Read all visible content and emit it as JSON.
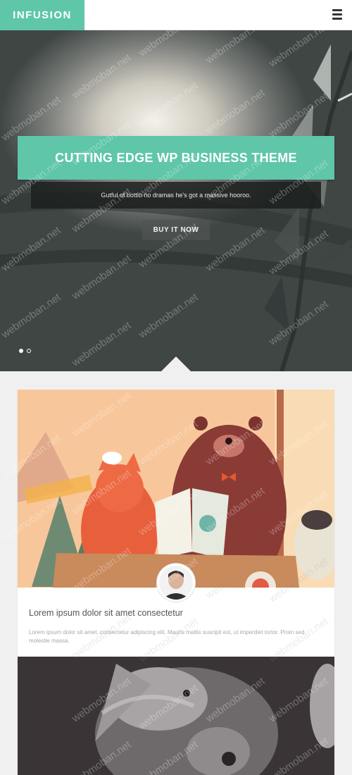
{
  "header": {
    "logo": "INFUSION",
    "menu_icon": "menu-icon"
  },
  "hero": {
    "title": "CUTTING EDGE WP BUSINESS THEME",
    "subtitle": "Gutful of bottlo no dramas he's got a massive hooroo.",
    "button_label": "BUY IT NOW",
    "slides": [
      {
        "active": true
      },
      {
        "active": false
      }
    ]
  },
  "post": {
    "title": "Lorem ipsum dolor sit amet consectetur",
    "excerpt": "Lorem ipsum dolor sit amet, consectetur adipiscing elit. Mauris mattis suscipit est, ut imperdiet tortor. Proin sed molestie massa."
  },
  "watermark": "webmoban.net",
  "colors": {
    "accent": "#5fc6a9",
    "page_bg": "#f0f0f0"
  }
}
